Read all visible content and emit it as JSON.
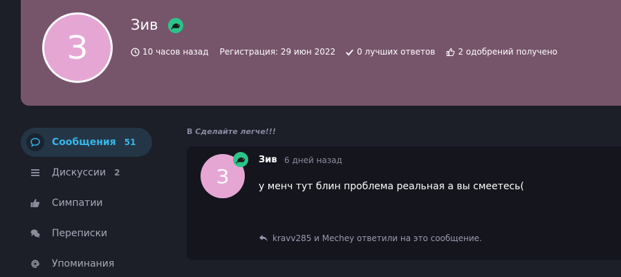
{
  "profile": {
    "avatar_letter": "З",
    "avatar_color": "#e6a6d4",
    "name": "Зив",
    "badge_icon": "rat-icon",
    "last_seen": "10 часов назад",
    "registration": "Регистрация: 29 июн 2022",
    "best_answers": "0 лучших ответов",
    "likes_received": "2 одобрений получено"
  },
  "nav": {
    "items": [
      {
        "label": "Сообщения",
        "count": "51",
        "icon": "comment-icon",
        "active": true
      },
      {
        "label": "Дискуссии",
        "count": "2",
        "icon": "list-icon",
        "active": false
      },
      {
        "label": "Симпатии",
        "count": "",
        "icon": "thumbs-up-icon",
        "active": false
      },
      {
        "label": "Переписки",
        "count": "",
        "icon": "conversation-icon",
        "active": false
      },
      {
        "label": "Упоминания",
        "count": "",
        "icon": "at-icon",
        "active": false
      }
    ]
  },
  "post": {
    "context_prefix": "В",
    "context_thread": "Сделайте легче!!!",
    "avatar_letter": "З",
    "author": "Зив",
    "time": "6 дней назад",
    "body": "у менч тут блин проблема реальная а вы смеетесь(",
    "replies": "kravv285 и Mechey ответили на это сообщение."
  },
  "colors": {
    "header_bg": "#76556b",
    "page_bg": "#1c1e28",
    "accent": "#38b6ea",
    "badge": "#2cc48a"
  }
}
